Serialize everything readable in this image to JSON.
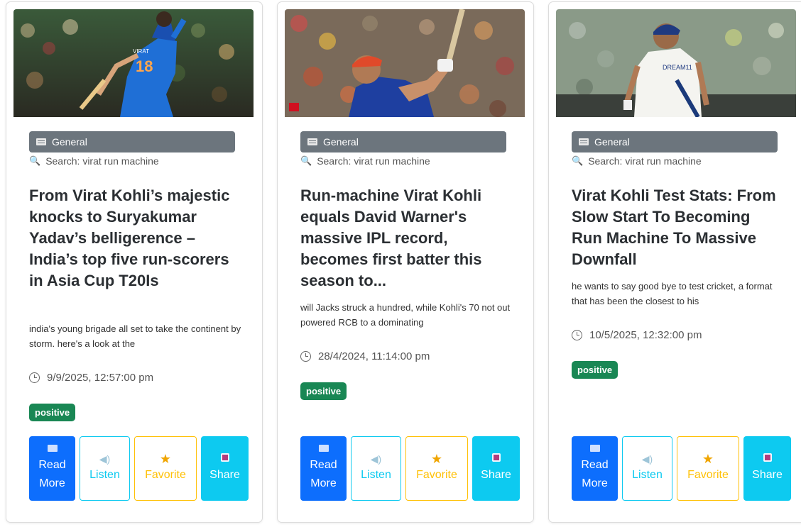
{
  "cards": [
    {
      "category": "General",
      "search": "Search: virat run machine",
      "title": "From Virat Kohli’s majestic knocks to Suryakumar Yadav’s belligerence – India’s top five run-scorers in Asia Cup T20Is",
      "description": "india's young brigade all set to take the continent by storm. here's a look at the",
      "date": "9/9/2025, 12:57:00 pm",
      "sentiment": "positive",
      "image_label": "VIRAT 18"
    },
    {
      "category": "General",
      "search": "Search: virat run machine",
      "title": "Run-machine Virat Kohli equals David Warner's massive IPL record, becomes first batter this season to...",
      "description": "will Jacks struck a hundred, while Kohli's 70 not out powered RCB to a dominating",
      "date": "28/4/2024, 11:14:00 pm",
      "sentiment": "positive"
    },
    {
      "category": "General",
      "search": "Search: virat run machine",
      "title": "Virat Kohli Test Stats: From Slow Start To Becoming Run Machine To Massive Downfall",
      "description": "he wants to say good bye to test cricket, a format that has been the closest to his",
      "date": "10/5/2025, 12:32:00 pm",
      "sentiment": "positive"
    }
  ],
  "buttons": {
    "read_more": "Read More",
    "listen": "Listen",
    "favorite": "Favorite",
    "share": "Share"
  },
  "icons": {
    "category": "newspaper-icon",
    "search": "magnifier-icon",
    "date": "clock-icon",
    "read_more": "book-icon",
    "listen": "speaker-icon",
    "favorite": "star-icon",
    "share": "share-icon"
  },
  "colors": {
    "read_more": "#0d6efd",
    "listen": "#0dcaf0",
    "favorite": "#ffc107",
    "share": "#0dcaf0",
    "category_badge": "#6c757d",
    "sentiment_positive": "#198754"
  }
}
